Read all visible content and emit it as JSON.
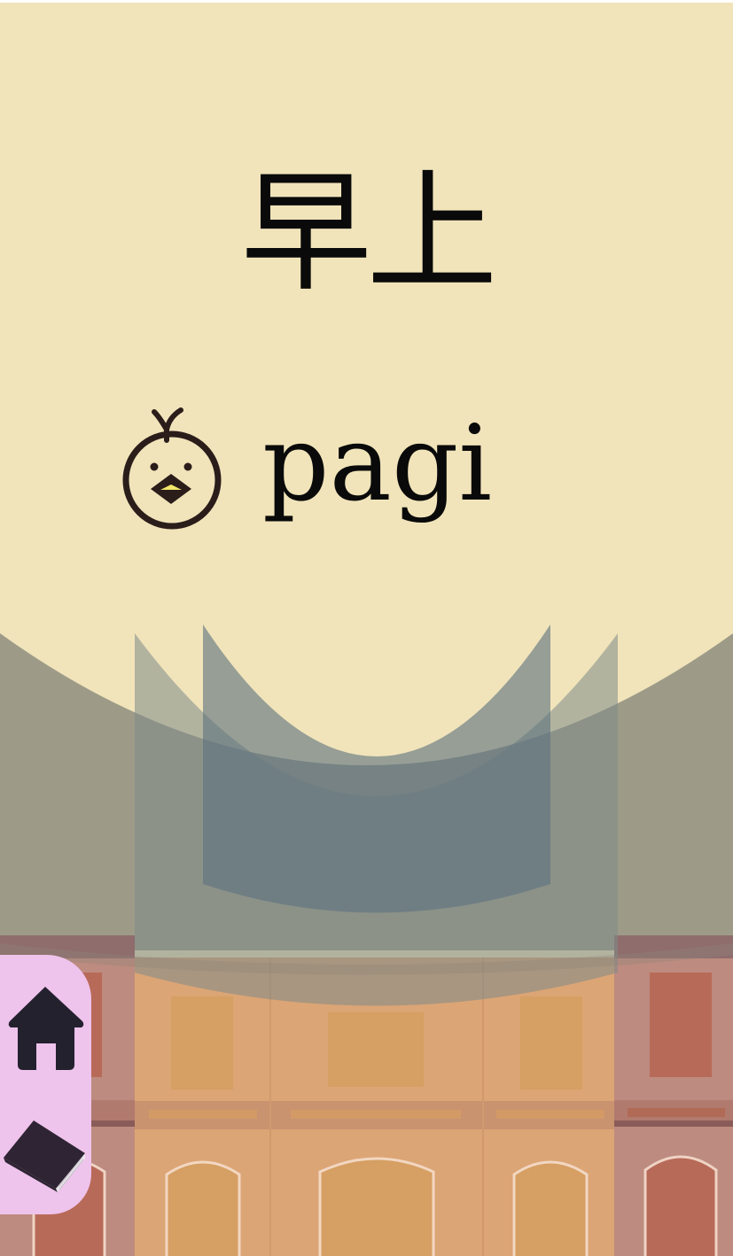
{
  "word": {
    "chinese": "早上",
    "indonesian": "pagi"
  },
  "icons": {
    "chick": "chick-icon",
    "home": "home-icon",
    "book": "book-icon"
  },
  "colors": {
    "sky": "#f1e4ba",
    "nav_panel": "#eec3ec",
    "nav_icon": "#23212e",
    "building_center": "#dca575",
    "building_side": "#bd8a7d",
    "curtain": "#5e7280"
  }
}
